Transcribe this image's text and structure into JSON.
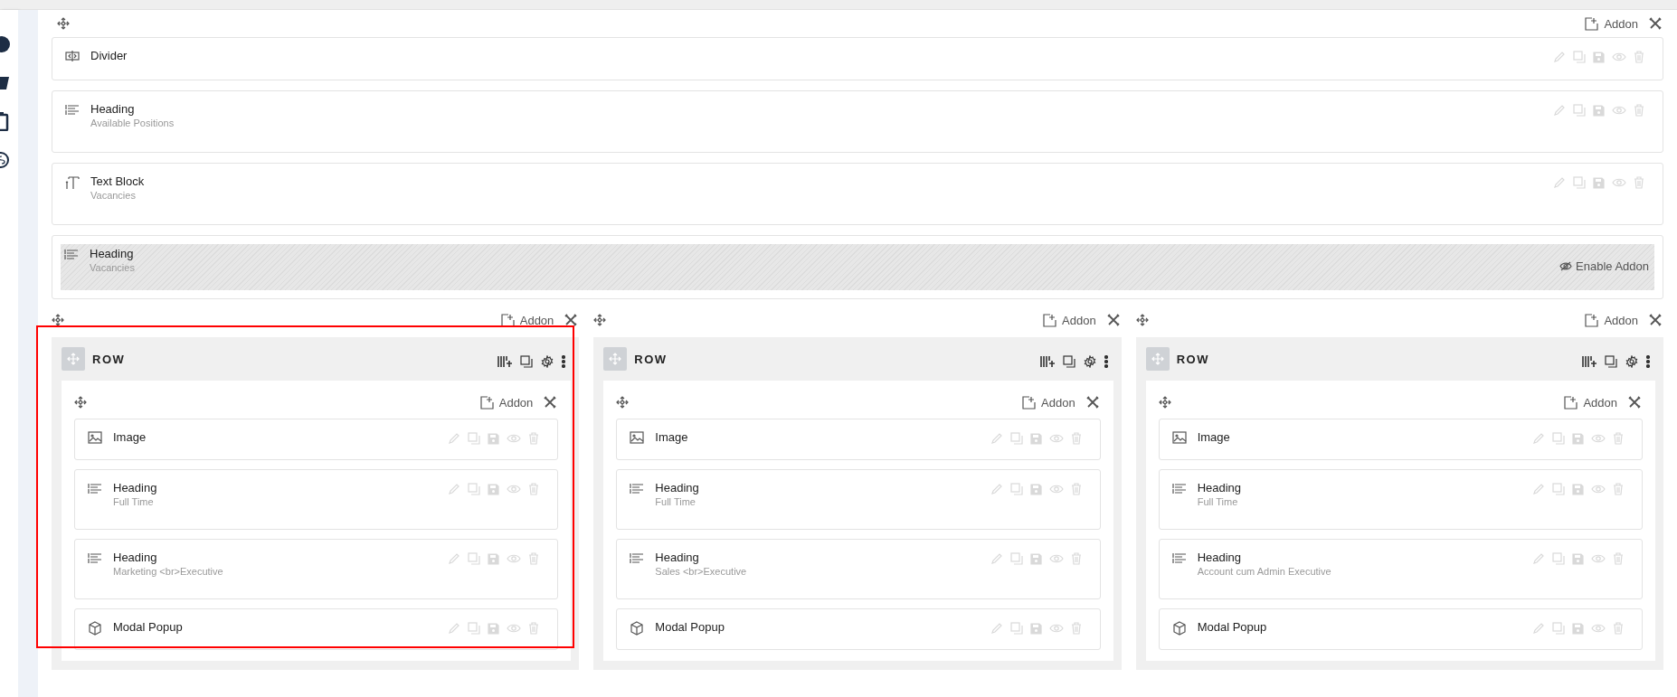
{
  "top_section": {
    "toolbar": {
      "add_label": "Addon"
    },
    "items": [
      {
        "kind": "divider",
        "title": "Divider",
        "disabled": false
      },
      {
        "kind": "heading",
        "title": "Heading",
        "subtitle": "Available Positions",
        "disabled": false
      },
      {
        "kind": "text_block",
        "title": "Text Block",
        "subtitle": "Vacancies",
        "disabled": false
      },
      {
        "kind": "heading",
        "title": "Heading",
        "subtitle": "Vacancies",
        "disabled": true,
        "enable_label": "Enable Addon"
      }
    ]
  },
  "columns": [
    {
      "highlighted": true,
      "toolbar": {
        "add_label": "Addon"
      },
      "row": {
        "label": "ROW",
        "toolbar": {
          "add_label": "Addon"
        },
        "items": [
          {
            "kind": "image",
            "title": "Image",
            "disabled": false
          },
          {
            "kind": "heading",
            "title": "Heading",
            "subtitle": "Full Time",
            "disabled": false
          },
          {
            "kind": "heading",
            "title": "Heading",
            "subtitle": "Marketing <br>Executive",
            "disabled": false
          },
          {
            "kind": "modal_popup",
            "title": "Modal Popup",
            "disabled": false
          }
        ]
      }
    },
    {
      "highlighted": false,
      "toolbar": {
        "add_label": "Addon"
      },
      "row": {
        "label": "ROW",
        "toolbar": {
          "add_label": "Addon"
        },
        "items": [
          {
            "kind": "image",
            "title": "Image",
            "disabled": false
          },
          {
            "kind": "heading",
            "title": "Heading",
            "subtitle": "Full Time",
            "disabled": false
          },
          {
            "kind": "heading",
            "title": "Heading",
            "subtitle": "Sales <br>Executive",
            "disabled": false
          },
          {
            "kind": "modal_popup",
            "title": "Modal Popup",
            "disabled": false
          }
        ]
      }
    },
    {
      "highlighted": false,
      "toolbar": {
        "add_label": "Addon"
      },
      "row": {
        "label": "ROW",
        "toolbar": {
          "add_label": "Addon"
        },
        "items": [
          {
            "kind": "image",
            "title": "Image",
            "disabled": false
          },
          {
            "kind": "heading",
            "title": "Heading",
            "subtitle": "Full Time",
            "disabled": false
          },
          {
            "kind": "heading",
            "title": "Heading",
            "subtitle": "Account cum Admin Executive",
            "disabled": false
          },
          {
            "kind": "modal_popup",
            "title": "Modal Popup",
            "disabled": false
          }
        ]
      }
    }
  ]
}
